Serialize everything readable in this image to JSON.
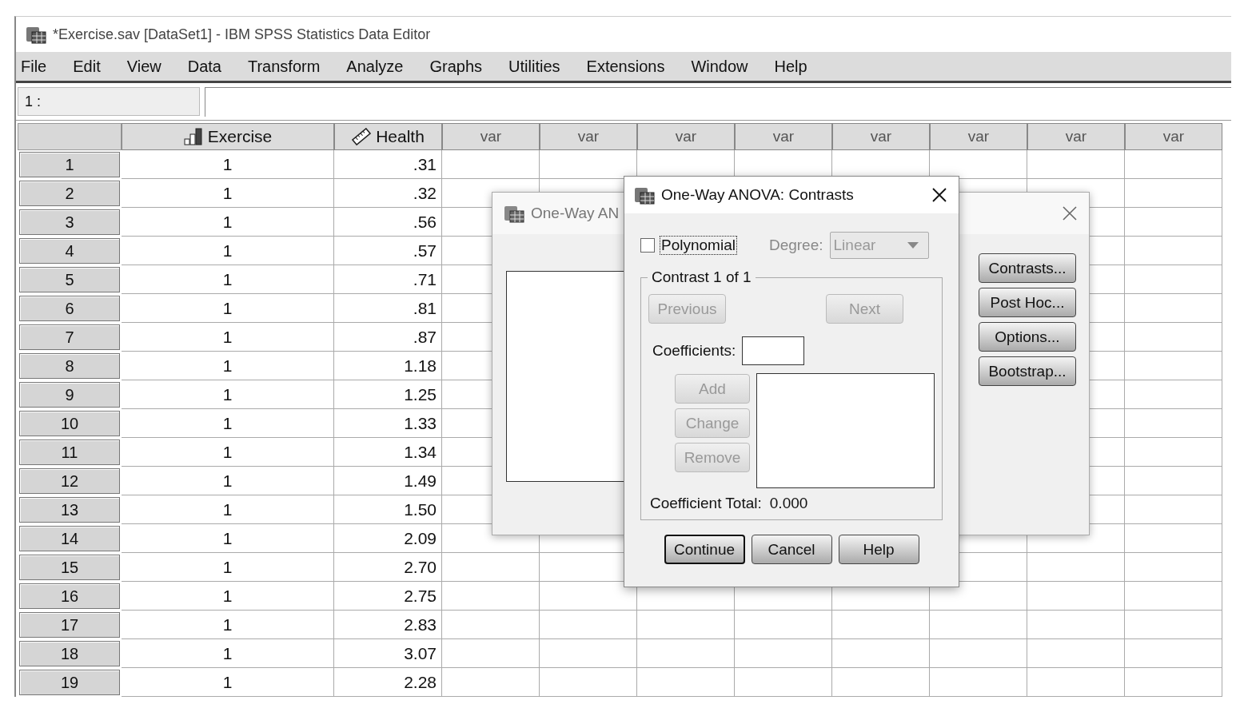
{
  "window": {
    "title": "*Exercise.sav [DataSet1] - IBM SPSS Statistics Data Editor"
  },
  "menu": [
    "File",
    "Edit",
    "View",
    "Data",
    "Transform",
    "Analyze",
    "Graphs",
    "Utilities",
    "Extensions",
    "Window",
    "Help"
  ],
  "cell_ref": {
    "label": "1 :"
  },
  "grid": {
    "columns": [
      {
        "name": "Exercise",
        "kind": "ordinal"
      },
      {
        "name": "Health",
        "kind": "scale"
      },
      {
        "name": "var",
        "kind": "empty"
      },
      {
        "name": "var",
        "kind": "empty"
      },
      {
        "name": "var",
        "kind": "empty"
      },
      {
        "name": "var",
        "kind": "empty"
      },
      {
        "name": "var",
        "kind": "empty"
      },
      {
        "name": "var",
        "kind": "empty"
      },
      {
        "name": "var",
        "kind": "empty"
      },
      {
        "name": "var",
        "kind": "empty"
      }
    ],
    "rows": [
      {
        "number": "1",
        "cells": [
          "1",
          ".31"
        ]
      },
      {
        "number": "2",
        "cells": [
          "1",
          ".32"
        ]
      },
      {
        "number": "3",
        "cells": [
          "1",
          ".56"
        ]
      },
      {
        "number": "4",
        "cells": [
          "1",
          ".57"
        ]
      },
      {
        "number": "5",
        "cells": [
          "1",
          ".71"
        ]
      },
      {
        "number": "6",
        "cells": [
          "1",
          ".81"
        ]
      },
      {
        "number": "7",
        "cells": [
          "1",
          ".87"
        ]
      },
      {
        "number": "8",
        "cells": [
          "1",
          "1.18"
        ]
      },
      {
        "number": "9",
        "cells": [
          "1",
          "1.25"
        ]
      },
      {
        "number": "10",
        "cells": [
          "1",
          "1.33"
        ]
      },
      {
        "number": "11",
        "cells": [
          "1",
          "1.34"
        ]
      },
      {
        "number": "12",
        "cells": [
          "1",
          "1.49"
        ]
      },
      {
        "number": "13",
        "cells": [
          "1",
          "1.50"
        ]
      },
      {
        "number": "14",
        "cells": [
          "1",
          "2.09"
        ]
      },
      {
        "number": "15",
        "cells": [
          "1",
          "2.70"
        ]
      },
      {
        "number": "16",
        "cells": [
          "1",
          "2.75"
        ]
      },
      {
        "number": "17",
        "cells": [
          "1",
          "2.83"
        ]
      },
      {
        "number": "18",
        "cells": [
          "1",
          "3.07"
        ]
      },
      {
        "number": "19",
        "cells": [
          "1",
          "2.28"
        ]
      }
    ]
  },
  "back_dialog": {
    "title": "One-Way AN",
    "buttons": [
      "Contrasts...",
      "Post Hoc...",
      "Options...",
      "Bootstrap..."
    ]
  },
  "contrasts_dialog": {
    "title": "One-Way ANOVA: Contrasts",
    "polynomial": {
      "label": "Polynomial",
      "checked": false
    },
    "degree": {
      "label": "Degree:",
      "value": "Linear",
      "disabled": true
    },
    "group": {
      "legend": "Contrast 1 of 1",
      "nav_buttons": [
        {
          "label": "Previous",
          "disabled": true
        },
        {
          "label": "Next",
          "disabled": true
        }
      ],
      "coefficients": {
        "label": "Coefficients:"
      },
      "edit_buttons": [
        {
          "label": "Add",
          "disabled": true
        },
        {
          "label": "Change",
          "disabled": true
        },
        {
          "label": "Remove",
          "disabled": true
        }
      ],
      "total": {
        "label": "Coefficient Total:",
        "value": "0.000"
      }
    },
    "buttons": [
      {
        "label": "Continue",
        "default": true
      },
      {
        "label": "Cancel",
        "default": false
      },
      {
        "label": "Help",
        "default": false
      }
    ]
  }
}
